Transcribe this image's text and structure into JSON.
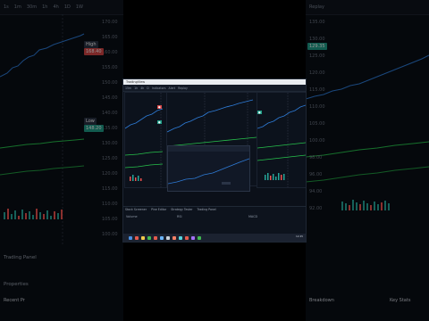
{
  "left_panel": {
    "toolbar": [
      "1s",
      "1m",
      "30m",
      "1h",
      "4h",
      "1D",
      "1W"
    ],
    "price_ticks": [
      "170.00",
      "165.00",
      "160.00",
      "155.00",
      "150.00",
      "145.00",
      "140.00",
      "135.00",
      "130.00",
      "125.00",
      "120.00",
      "115.00",
      "110.00",
      "105.00",
      "100.00"
    ],
    "high_badge": "High",
    "high_value": "168.40",
    "low_badge": "Low",
    "low_value": "148.20",
    "tabs": [
      "Trading Panel",
      "Properties"
    ],
    "footer_label": "Recent Pr"
  },
  "right_panel": {
    "toolbar": [
      "Replay"
    ],
    "price_ticks": [
      "135.00",
      "130.00",
      "125.00",
      "120.00",
      "115.00",
      "110.00",
      "105.00",
      "100.00",
      "98.00",
      "96.00",
      "94.00",
      "92.00"
    ],
    "badge_value": "129.35",
    "footer_left": "Breakdown",
    "footer_right": "Key Stats"
  },
  "center_window": {
    "title": "TradingView",
    "toolbar": [
      "15m",
      "1h",
      "4h",
      "D",
      "Indicators",
      "Alert",
      "Replay"
    ],
    "bottom_tabs": [
      "Stock Screener",
      "Pine Editor",
      "Strategy Tester",
      "Trading Panel"
    ],
    "bottom_labels": [
      "Volume",
      "RSI",
      "MACD"
    ],
    "taskbar_time": "12:45"
  },
  "colors": {
    "price_line": "#2e7bd6",
    "ma_green": "#27c24c",
    "up": "#26a69a",
    "down": "#ef5350",
    "badge_red": "#d64545",
    "badge_teal": "#1f9e88"
  }
}
